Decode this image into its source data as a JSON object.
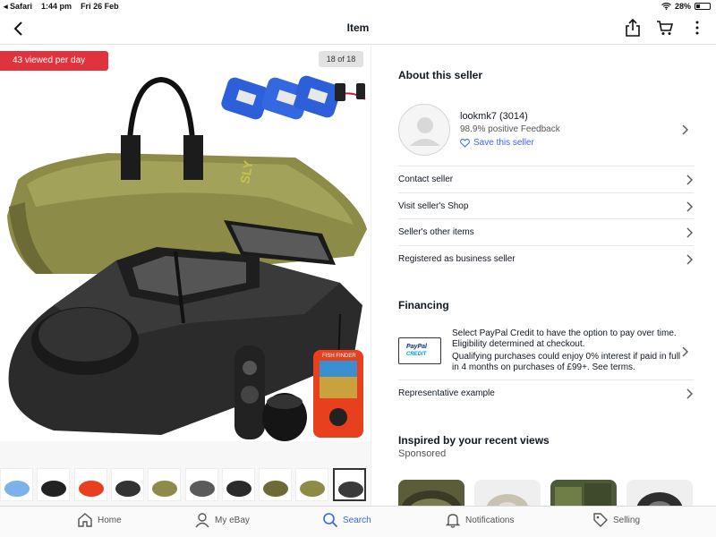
{
  "status_bar": {
    "back_app": "◂ Safari",
    "time": "1:44 pm",
    "date": "Fri 26 Feb",
    "battery_percent": "28%",
    "battery_level": 0.28
  },
  "nav": {
    "title": "Item",
    "icons": [
      "back-chevron-icon",
      "share-icon",
      "cart-icon",
      "more-icon"
    ]
  },
  "image_panel": {
    "views_badge": "43 viewed per day",
    "page_counter": "18 of 18",
    "thumbnail_count": 10,
    "selected_thumbnail_index": 9
  },
  "seller": {
    "section_title": "About this seller",
    "name": "lookmk7 (3014)",
    "feedback": "98.9% positive Feedback",
    "save_label": "Save this seller",
    "rows": [
      {
        "label": "Contact seller"
      },
      {
        "label": "Visit seller's Shop"
      },
      {
        "label": "Seller's other items"
      },
      {
        "label": "Registered as business seller"
      }
    ]
  },
  "financing": {
    "section_title": "Financing",
    "paypal_line1": "PayPal",
    "paypal_line2": "CREDIT",
    "text1": "Select PayPal Credit to have the option to pay over time. Eligibility determined at checkout.",
    "text2": "Qualifying purchases could enjoy 0% interest if paid in full in 4 months on purchases of £99+. See terms.",
    "representative_label": "Representative example"
  },
  "recommendations": {
    "section_title": "Inspired by your recent views",
    "subtitle": "Sponsored"
  },
  "tabs": [
    {
      "label": "Home",
      "icon": "home-icon",
      "active": false
    },
    {
      "label": "My eBay",
      "icon": "person-icon",
      "active": false
    },
    {
      "label": "Search",
      "icon": "search-icon",
      "active": true
    },
    {
      "label": "Notifications",
      "icon": "bell-icon",
      "active": false
    },
    {
      "label": "Selling",
      "icon": "tag-icon",
      "active": false
    }
  ],
  "colors": {
    "accent": "#3665f3",
    "badge": "#e0333d"
  }
}
